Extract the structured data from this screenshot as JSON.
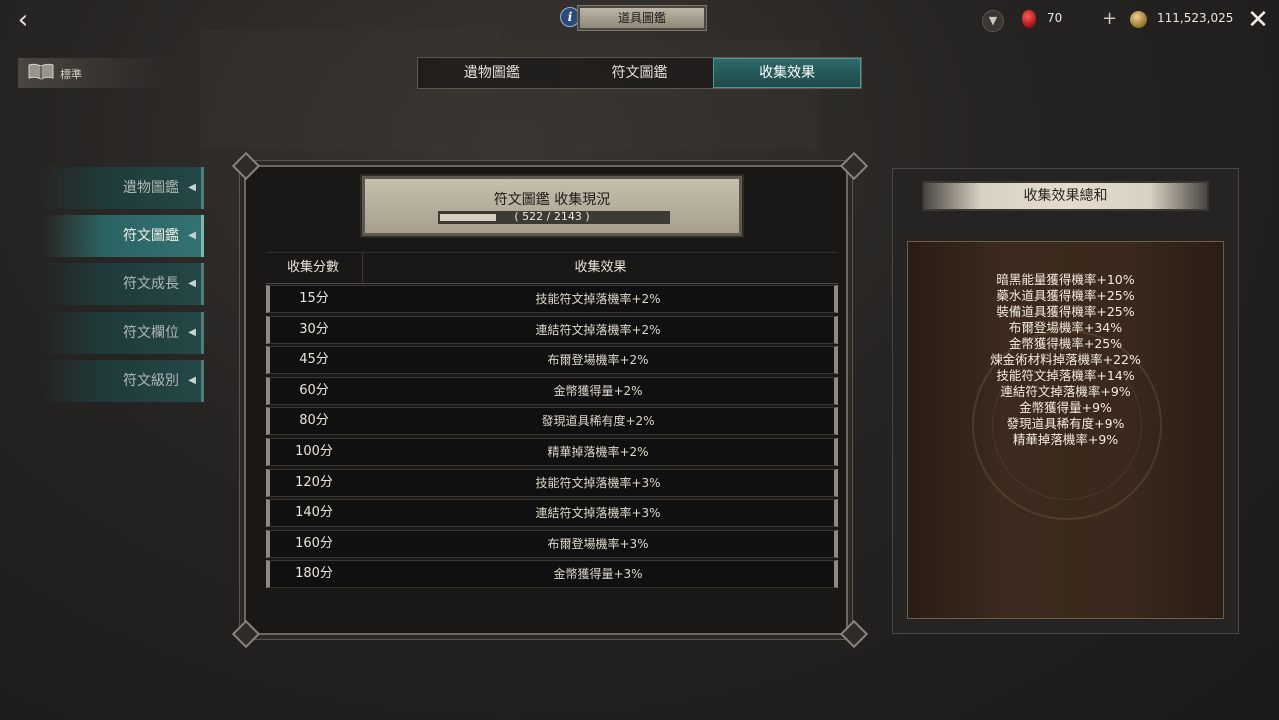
{
  "header": {
    "title": "道具圖鑑",
    "gem_count": "70",
    "gold_count": "111,523,025"
  },
  "mode": {
    "label": "標準"
  },
  "tabs": [
    {
      "label": "遺物圖鑑",
      "active": false
    },
    {
      "label": "符文圖鑑",
      "active": false
    },
    {
      "label": "收集效果",
      "active": true
    }
  ],
  "sidebar": {
    "items": [
      {
        "label": "遺物圖鑑",
        "active": false
      },
      {
        "label": "符文圖鑑",
        "active": true
      },
      {
        "label": "符文成長",
        "active": false
      },
      {
        "label": "符文欄位",
        "active": false
      },
      {
        "label": "符文級別",
        "active": false
      }
    ]
  },
  "status": {
    "title": "符文圖鑑 收集現況",
    "progress_text": "( 522 / 2143 )",
    "collected": 522,
    "total": 2143
  },
  "table": {
    "col_score": "收集分數",
    "col_effect": "收集效果",
    "rows": [
      {
        "score": "15分",
        "effect": "技能符文掉落機率+2%"
      },
      {
        "score": "30分",
        "effect": "連結符文掉落機率+2%"
      },
      {
        "score": "45分",
        "effect": "布爾登場機率+2%"
      },
      {
        "score": "60分",
        "effect": "金幣獲得量+2%"
      },
      {
        "score": "80分",
        "effect": "發現道具稀有度+2%"
      },
      {
        "score": "100分",
        "effect": "精華掉落機率+2%"
      },
      {
        "score": "120分",
        "effect": "技能符文掉落機率+3%"
      },
      {
        "score": "140分",
        "effect": "連結符文掉落機率+3%"
      },
      {
        "score": "160分",
        "effect": "布爾登場機率+3%"
      },
      {
        "score": "180分",
        "effect": "金幣獲得量+3%"
      }
    ]
  },
  "summary": {
    "title": "收集效果總和",
    "lines": [
      "暗黑能量獲得機率+10%",
      "藥水道具獲得機率+25%",
      "裝備道具獲得機率+25%",
      "布爾登場機率+34%",
      "金幣獲得機率+25%",
      "煉金術材料掉落機率+22%",
      "技能符文掉落機率+14%",
      "連結符文掉落機率+9%",
      "金幣獲得量+9%",
      "發現道具稀有度+9%",
      "精華掉落機率+9%"
    ]
  }
}
